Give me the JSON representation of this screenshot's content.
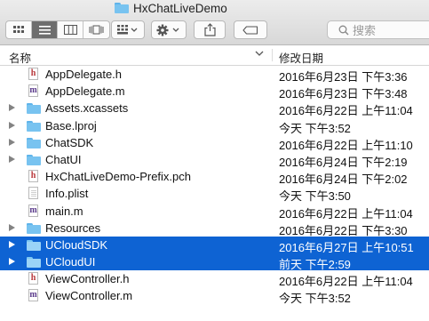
{
  "window": {
    "title": "HxChatLiveDemo"
  },
  "toolbar": {
    "search_placeholder": "搜索",
    "colors": {
      "selected": "#0e63d3",
      "folder": "#78c3f0"
    }
  },
  "columns": {
    "name": "名称",
    "date": "修改日期"
  },
  "files": [
    {
      "name": "AppDelegate.h",
      "date": "2016年6月23日 下午3:36",
      "icon": "header-file-icon",
      "letter": "h",
      "letter_color": "#b8373a",
      "expandable": false,
      "selected": false
    },
    {
      "name": "AppDelegate.m",
      "date": "2016年6月23日 下午3:48",
      "icon": "source-file-icon",
      "letter": "m",
      "letter_color": "#5a3a8a",
      "expandable": false,
      "selected": false
    },
    {
      "name": "Assets.xcassets",
      "date": "2016年6月22日 上午11:04",
      "icon": "folder-icon",
      "expandable": true,
      "selected": false
    },
    {
      "name": "Base.lproj",
      "date": "今天 下午3:52",
      "icon": "folder-icon",
      "expandable": true,
      "selected": false
    },
    {
      "name": "ChatSDK",
      "date": "2016年6月22日 上午11:10",
      "icon": "folder-icon",
      "expandable": true,
      "selected": false
    },
    {
      "name": "ChatUI",
      "date": "2016年6月24日 下午2:19",
      "icon": "folder-icon",
      "expandable": true,
      "selected": false
    },
    {
      "name": "HxChatLiveDemo-Prefix.pch",
      "date": "2016年6月24日 下午2:02",
      "icon": "header-file-icon",
      "letter": "h",
      "letter_color": "#b8373a",
      "expandable": false,
      "selected": false
    },
    {
      "name": "Info.plist",
      "date": "今天 下午3:50",
      "icon": "plist-file-icon",
      "letter": "",
      "letter_color": "#888888",
      "expandable": false,
      "selected": false
    },
    {
      "name": "main.m",
      "date": "2016年6月22日 上午11:04",
      "icon": "source-file-icon",
      "letter": "m",
      "letter_color": "#5a3a8a",
      "expandable": false,
      "selected": false
    },
    {
      "name": "Resources",
      "date": "2016年6月22日 下午3:30",
      "icon": "folder-icon",
      "expandable": true,
      "selected": false
    },
    {
      "name": "UCloudSDK",
      "date": "2016年6月27日 上午10:51",
      "icon": "folder-icon",
      "expandable": true,
      "selected": true
    },
    {
      "name": "UCloudUI",
      "date": "前天 下午2:59",
      "icon": "folder-icon",
      "expandable": true,
      "selected": true
    },
    {
      "name": "ViewController.h",
      "date": "2016年6月22日 上午11:04",
      "icon": "header-file-icon",
      "letter": "h",
      "letter_color": "#b8373a",
      "expandable": false,
      "selected": false
    },
    {
      "name": "ViewController.m",
      "date": "今天 下午3:52",
      "icon": "source-file-icon",
      "letter": "m",
      "letter_color": "#5a3a8a",
      "expandable": false,
      "selected": false
    }
  ]
}
